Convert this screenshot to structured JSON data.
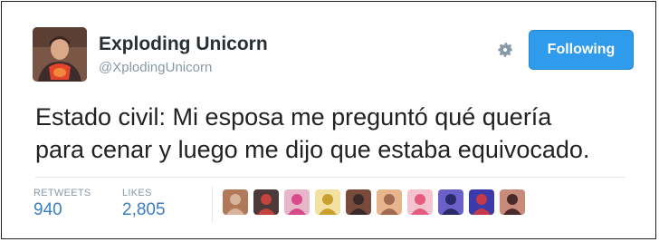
{
  "author": {
    "name": "Exploding Unicorn",
    "handle": "@XplodingUnicorn",
    "avatar_icon": "user-avatar-icon"
  },
  "actions": {
    "settings_icon": "gear-icon",
    "follow_label": "Following",
    "follow_color": "#2f9bea"
  },
  "tweet": {
    "lines": [
      "Estado civil: Mi esposa me preguntó qué quería",
      "para cenar y luego me dijo que estaba equivocado."
    ]
  },
  "stats": {
    "retweets_label": "RETWEETS",
    "retweets_value": "940",
    "likes_label": "LIKES",
    "likes_value": "2,805"
  },
  "likers": [
    {
      "icon": "liker-avatar-icon",
      "colors": [
        "#b07a5a",
        "#d8b49c"
      ]
    },
    {
      "icon": "liker-avatar-icon",
      "colors": [
        "#4a3a3a",
        "#c4433c"
      ]
    },
    {
      "icon": "liker-avatar-icon",
      "colors": [
        "#e7b7c9",
        "#d84a8a"
      ]
    },
    {
      "icon": "liker-avatar-icon",
      "colors": [
        "#f2e1a0",
        "#c9a030"
      ]
    },
    {
      "icon": "liker-avatar-icon",
      "colors": [
        "#7a4a3a",
        "#3a2a2a"
      ]
    },
    {
      "icon": "liker-avatar-icon",
      "colors": [
        "#e8b48c",
        "#a06a50"
      ]
    },
    {
      "icon": "liker-avatar-icon",
      "colors": [
        "#f4c3cf",
        "#e45c7e"
      ]
    },
    {
      "icon": "liker-avatar-icon",
      "colors": [
        "#6a60c8",
        "#2a2a6a"
      ]
    },
    {
      "icon": "liker-avatar-icon",
      "colors": [
        "#3a3aa8",
        "#c43a4a"
      ]
    },
    {
      "icon": "liker-avatar-icon",
      "colors": [
        "#c88a7a",
        "#4a2a2a"
      ]
    }
  ]
}
